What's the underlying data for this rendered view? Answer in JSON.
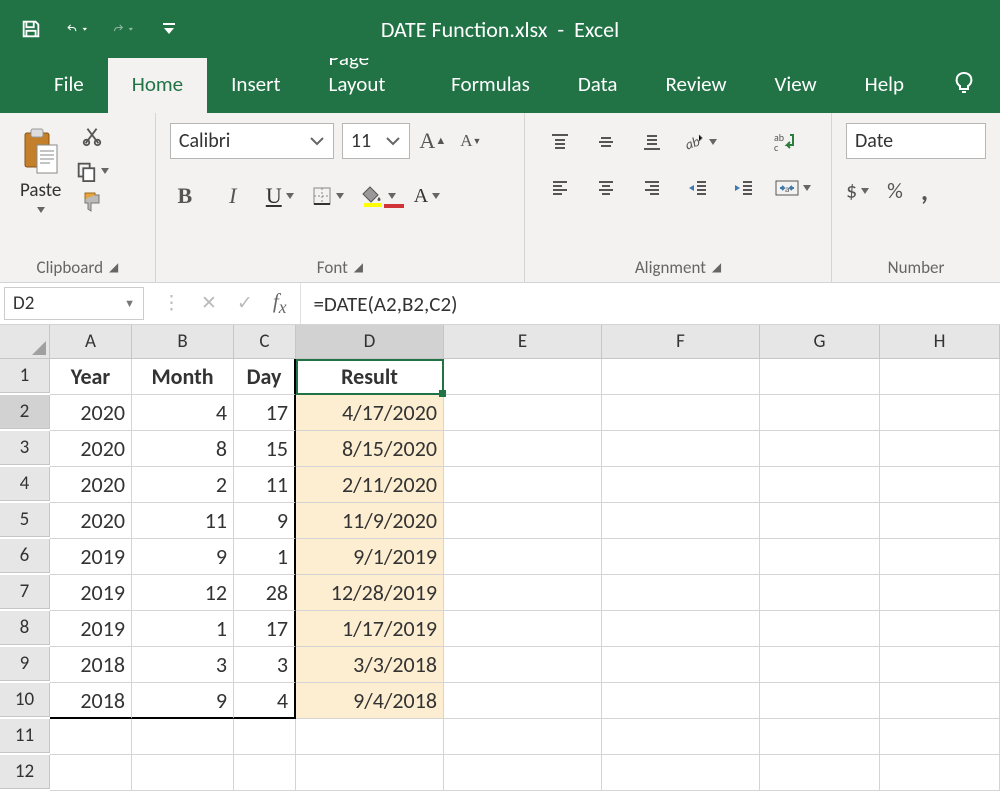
{
  "app": {
    "filename": "DATE Function.xlsx",
    "app_name": "Excel"
  },
  "tabs": {
    "file": "File",
    "home": "Home",
    "insert": "Insert",
    "page_layout": "Page Layout",
    "formulas": "Formulas",
    "data": "Data",
    "review": "Review",
    "view": "View",
    "help": "Help"
  },
  "ribbon": {
    "clipboard": {
      "label": "Clipboard",
      "paste": "Paste"
    },
    "font": {
      "label": "Font",
      "name": "Calibri",
      "size": "11"
    },
    "alignment": {
      "label": "Alignment"
    },
    "number": {
      "label": "Number",
      "format": "Date",
      "currency": "$",
      "percent": "%",
      "comma": ","
    }
  },
  "formula": {
    "name_box": "D2",
    "value": "=DATE(A2,B2,C2)"
  },
  "columns": [
    "A",
    "B",
    "C",
    "D",
    "E",
    "F",
    "G",
    "H"
  ],
  "row_numbers": [
    "1",
    "2",
    "3",
    "4",
    "5",
    "6",
    "7",
    "8",
    "9",
    "10",
    "11",
    "12"
  ],
  "headers": {
    "A": "Year",
    "B": "Month",
    "C": "Day",
    "D": "Result"
  },
  "rows": [
    {
      "A": "2020",
      "B": "4",
      "C": "17",
      "D": "4/17/2020"
    },
    {
      "A": "2020",
      "B": "8",
      "C": "15",
      "D": "8/15/2020"
    },
    {
      "A": "2020",
      "B": "2",
      "C": "11",
      "D": "2/11/2020"
    },
    {
      "A": "2020",
      "B": "11",
      "C": "9",
      "D": "11/9/2020"
    },
    {
      "A": "2019",
      "B": "9",
      "C": "1",
      "D": "9/1/2019"
    },
    {
      "A": "2019",
      "B": "12",
      "C": "28",
      "D": "12/28/2019"
    },
    {
      "A": "2019",
      "B": "1",
      "C": "17",
      "D": "1/17/2019"
    },
    {
      "A": "2018",
      "B": "3",
      "C": "3",
      "D": "3/3/2018"
    },
    {
      "A": "2018",
      "B": "9",
      "C": "4",
      "D": "9/4/2018"
    }
  ]
}
